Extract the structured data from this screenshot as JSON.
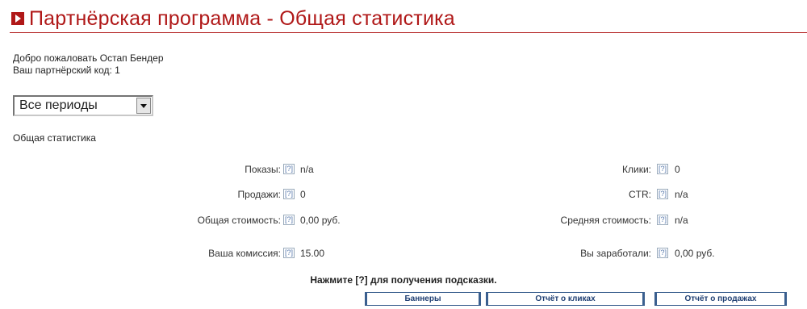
{
  "header": {
    "title": "Партнёрская программа - Общая статистика"
  },
  "welcome": {
    "line1": "Добро пожаловать Остап Бендер",
    "line2": "Ваш партнёрский код: 1"
  },
  "period": {
    "selected": "Все периоды"
  },
  "section_title": "Общая статистика",
  "help_glyph": "[?]",
  "stats_left": [
    {
      "label": "Показы:",
      "value": "n/a"
    },
    {
      "label": "Продажи:",
      "value": "0"
    },
    {
      "label": "Общая стоимость:",
      "value": "0,00 руб."
    },
    {
      "label": "Ваша комиссия:",
      "value": "15.00"
    }
  ],
  "stats_right": [
    {
      "label": "Клики:",
      "value": "0"
    },
    {
      "label": "CTR:",
      "value": "n/a"
    },
    {
      "label": "Средняя стоимость:",
      "value": "n/a"
    },
    {
      "label": "Вы заработали:",
      "value": "0,00 руб."
    }
  ],
  "hint": "Нажмите [?] для получения подсказки.",
  "buttons": {
    "banners": "Баннеры",
    "clicks_report": "Отчёт о кликах",
    "sales_report": "Отчёт о продажах"
  }
}
